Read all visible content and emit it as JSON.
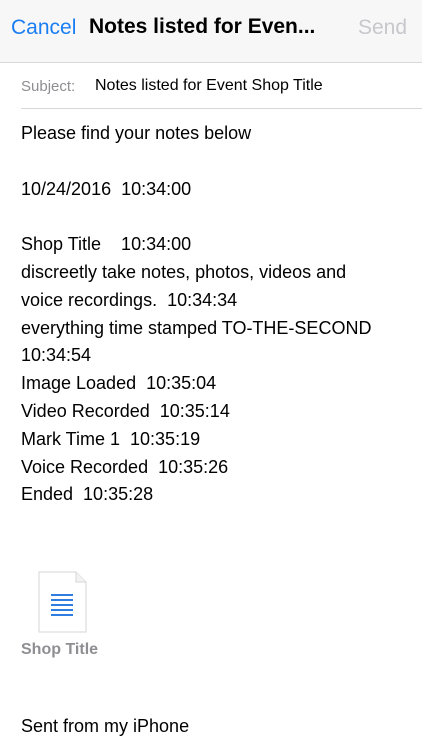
{
  "nav": {
    "cancel_label": "Cancel",
    "title": "Notes listed for Even...",
    "send_label": "Send"
  },
  "subject": {
    "label": "Subject:",
    "value": "Notes listed for Event Shop Title"
  },
  "body": {
    "lines": [
      "Please find your notes below",
      "",
      "10/24/2016  10:34:00",
      "",
      "Shop Title    10:34:00",
      "discreetly take notes, photos, videos and",
      "voice recordings.  10:34:34",
      "everything time stamped TO-THE-SECOND",
      "10:34:54",
      "Image Loaded  10:35:04",
      "Video Recorded  10:35:14",
      "Mark Time 1  10:35:19",
      "Voice Recorded  10:35:26",
      "Ended  10:35:28"
    ]
  },
  "attachment": {
    "name": "Shop Title",
    "icon": "document-icon"
  },
  "signature": "Sent from my iPhone",
  "colors": {
    "accent": "#1a7ef2",
    "disabled": "#c7c7cc",
    "secondary_text": "#8e8e93",
    "nav_background": "#f7f7f7"
  }
}
